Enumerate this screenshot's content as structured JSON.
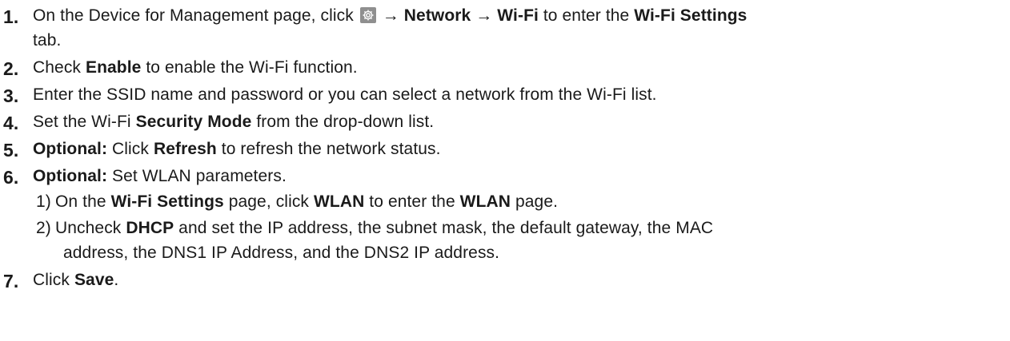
{
  "steps": [
    {
      "num": "1.",
      "lines": [
        {
          "p1": "On the Device for Management page, click ",
          "icon": "gear-icon",
          "p2": " ",
          "b1": "→ Network → Wi-Fi",
          "p3": " to enter the ",
          "b2": "Wi-Fi Settings"
        },
        {
          "p1": "tab."
        }
      ]
    },
    {
      "num": "2.",
      "p1": "Check ",
      "b1": "Enable",
      "p2": " to enable the Wi-Fi function."
    },
    {
      "num": "3.",
      "p1": "Enter the SSID name and password or you can select a network from the Wi-Fi list."
    },
    {
      "num": "4.",
      "p1": "Set the Wi-Fi ",
      "b1": "Security Mode",
      "p2": " from the drop-down list."
    },
    {
      "num": "5.",
      "b1": "Optional:",
      "p1": " Click ",
      "b2": "Refresh",
      "p2": " to refresh the network status."
    },
    {
      "num": "6.",
      "b1": "Optional:",
      "p1": " Set WLAN parameters.",
      "substeps": [
        {
          "num": "1)",
          "p1": "On the ",
          "b1": "Wi-Fi Settings",
          "p2": " page, click ",
          "b2": "WLAN",
          "p3": " to enter the ",
          "b3": "WLAN",
          "p4": " page."
        },
        {
          "num": "2)",
          "p1": "Uncheck ",
          "b1": "DHCP",
          "p2": " and set the IP address, the subnet mask, the default gateway, the MAC",
          "p3": "address, the DNS1 IP Address, and the DNS2 IP address."
        }
      ]
    },
    {
      "num": "7.",
      "p1": "Click ",
      "b1": "Save",
      "p2": "."
    }
  ]
}
